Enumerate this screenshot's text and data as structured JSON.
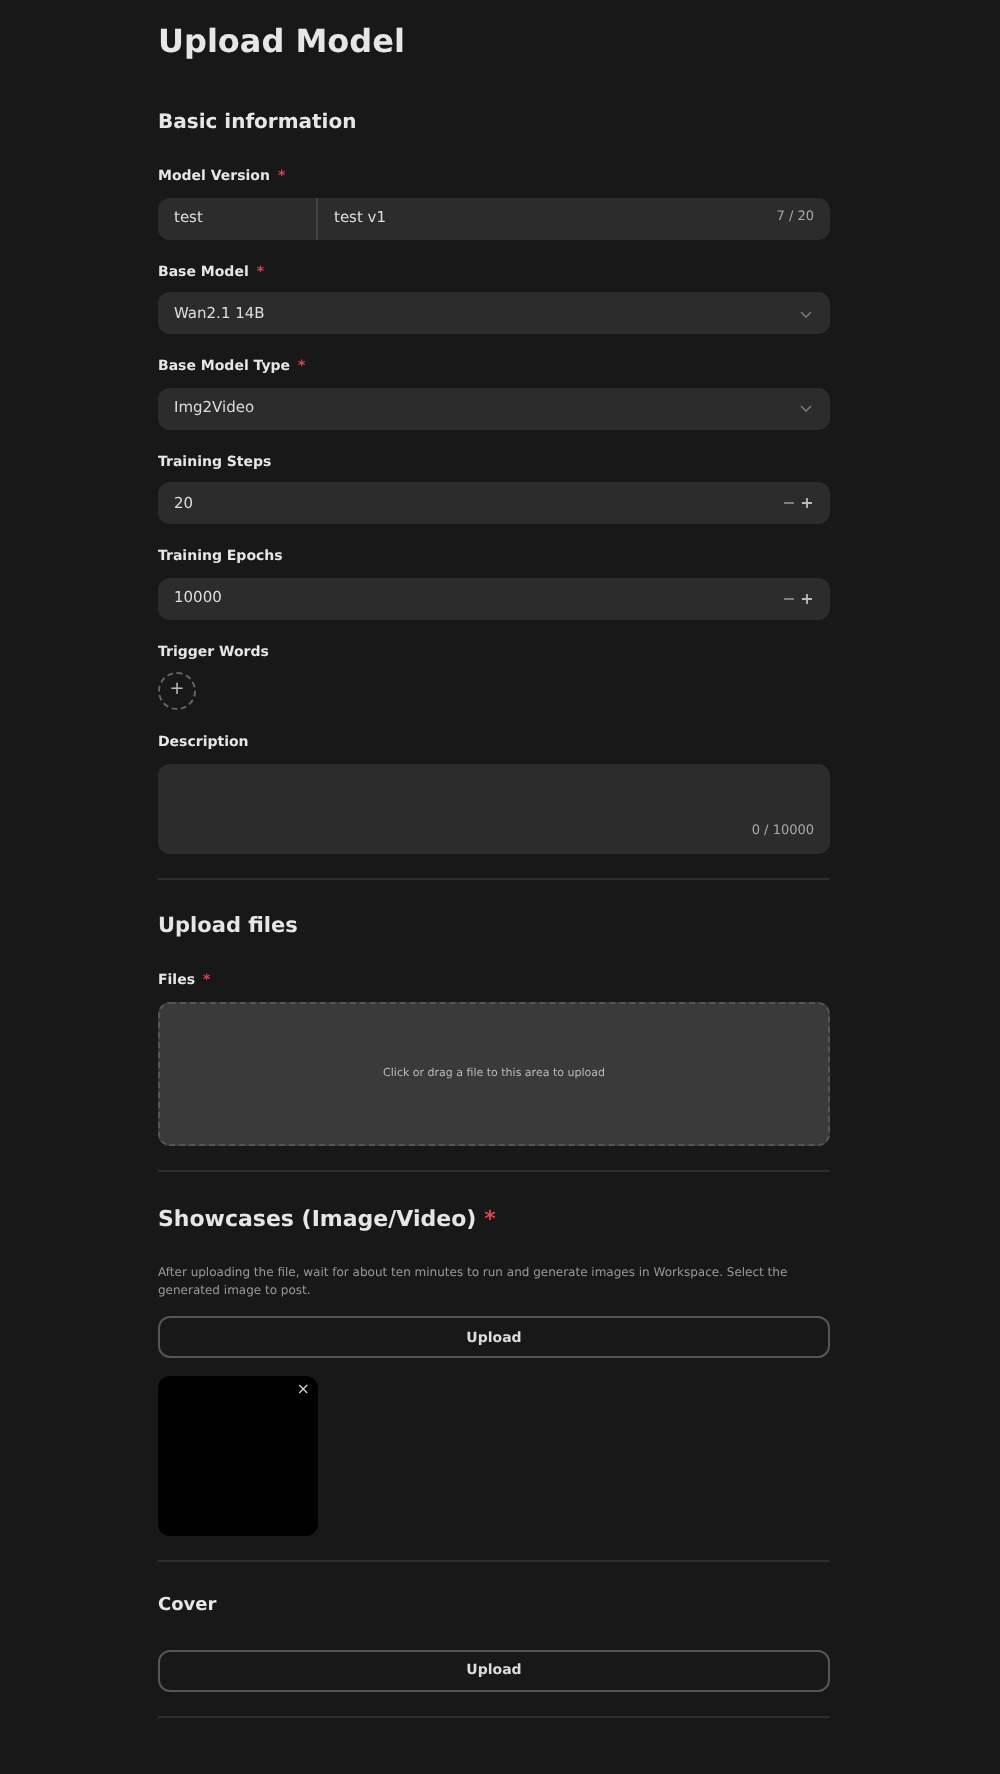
{
  "page_title": "Upload Model",
  "basic_information": {
    "heading": "Basic information",
    "model_version": {
      "label": "Model Version",
      "required_mark": "*",
      "prefix": "test",
      "value": "test v1",
      "counter": "7 / 20"
    },
    "base_model": {
      "label": "Base Model",
      "required_mark": "*",
      "value": "Wan2.1 14B"
    },
    "base_model_type": {
      "label": "Base Model Type",
      "required_mark": "*",
      "value": "Img2Video"
    },
    "training_steps": {
      "label": "Training Steps",
      "value": "20"
    },
    "training_epochs": {
      "label": "Training Epochs",
      "value": "10000"
    },
    "trigger_words": {
      "label": "Trigger Words",
      "add_button": "+"
    },
    "description": {
      "label": "Description",
      "counter": "0 / 10000"
    }
  },
  "upload_files": {
    "heading": "Upload files",
    "files": {
      "label": "Files",
      "required_mark": "*",
      "dropzone_text": "Click or drag a file to this area to upload"
    }
  },
  "showcases": {
    "heading": "Showcases (Image/Video)",
    "required_mark": "*",
    "hint": "After uploading the file, wait for about ten minutes to run and generate images in Workspace. Select the generated image to post.",
    "upload_button": "Upload",
    "items": [
      {
        "remove": "×"
      }
    ]
  },
  "cover": {
    "heading": "Cover",
    "upload_button": "Upload"
  }
}
